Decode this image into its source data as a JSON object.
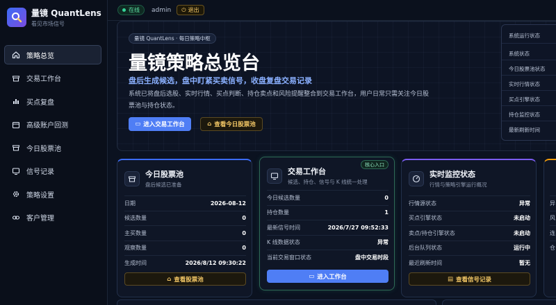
{
  "brand": {
    "name": "量镜 QuantLens",
    "sub": "看见市场信号"
  },
  "nav": [
    {
      "label": "策略总览",
      "icon": "home-icon",
      "active": true
    },
    {
      "label": "交易工作台",
      "icon": "store-icon"
    },
    {
      "label": "买点复盘",
      "icon": "bar-chart-icon"
    },
    {
      "label": "高级账户回测",
      "icon": "calendar-icon"
    },
    {
      "label": "今日股票池",
      "icon": "shop-icon"
    },
    {
      "label": "信号记录",
      "icon": "monitor-icon"
    },
    {
      "label": "策略设置",
      "icon": "gear-icon"
    },
    {
      "label": "客户管理",
      "icon": "link-icon"
    }
  ],
  "topbar": {
    "status": "在线",
    "user": "admin",
    "logout": "退出"
  },
  "hero": {
    "chip": "量镜 QuantLens · 每日策略中枢",
    "title": "量镜策略总览台",
    "subtitle": "盘后生成候选，盘中盯紧买卖信号，收盘复盘交易记录",
    "desc": "系统已将盘后选股、实时行情、买点判断、持仓卖点和风险提醒整合到交易工作台，用户日常只需关注今日股票池与持仓状态。",
    "btn_primary": "进入交易工作台",
    "btn_secondary": "查看今日股票池"
  },
  "status_panel": {
    "items": [
      "系统运行状态",
      "系统状态",
      "今日股票池状态",
      "实时行情状态",
      "买点引擎状态",
      "持仓监控状态",
      "最新刷新时间"
    ]
  },
  "cards": [
    {
      "title": "今日股票池",
      "sub": "盘后候选已准备",
      "icon": "shop-icon",
      "rows": [
        {
          "k": "日期",
          "v": "2026-08-12"
        },
        {
          "k": "候选数量",
          "v": "0"
        },
        {
          "k": "主买数量",
          "v": "0"
        },
        {
          "k": "观察数量",
          "v": "0"
        },
        {
          "k": "生成时间",
          "v": "2026/8/12 09:30:22"
        }
      ],
      "button": "查看股票池"
    },
    {
      "title": "交易工作台",
      "sub": "候选、持仓、信号与 K 线统一处理",
      "icon": "monitor-icon",
      "tag": "核心入口",
      "rows": [
        {
          "k": "今日候选数量",
          "v": "0"
        },
        {
          "k": "持仓数量",
          "v": "1"
        },
        {
          "k": "最新信号时间",
          "v": "2026/7/27 09:52:33"
        },
        {
          "k": "K 线数据状态",
          "v": "异常"
        },
        {
          "k": "当前交易窗口状态",
          "v": "盘中交易时段"
        }
      ],
      "button": "进入工作台"
    },
    {
      "title": "实时监控状态",
      "sub": "行情与策略引擎运行概况",
      "icon": "gauge-icon",
      "rows": [
        {
          "k": "行情源状态",
          "v": "异常"
        },
        {
          "k": "买点引擎状态",
          "v": "未启动"
        },
        {
          "k": "卖点/持仓引擎状态",
          "v": "未启动"
        },
        {
          "k": "后台队列状态",
          "v": "运行中"
        },
        {
          "k": "最近刷新时间",
          "v": "暂无"
        }
      ],
      "button": "查看信号记录"
    },
    {
      "rows": [
        {
          "k": "异",
          "v": ""
        },
        {
          "k": "风",
          "v": ""
        },
        {
          "k": "连",
          "v": ""
        },
        {
          "k": "仓",
          "v": ""
        }
      ]
    }
  ],
  "colors": {
    "accent": "#4f7ef5",
    "amber": "#f3c766",
    "green": "#34d399",
    "bg": "#0b1220"
  }
}
